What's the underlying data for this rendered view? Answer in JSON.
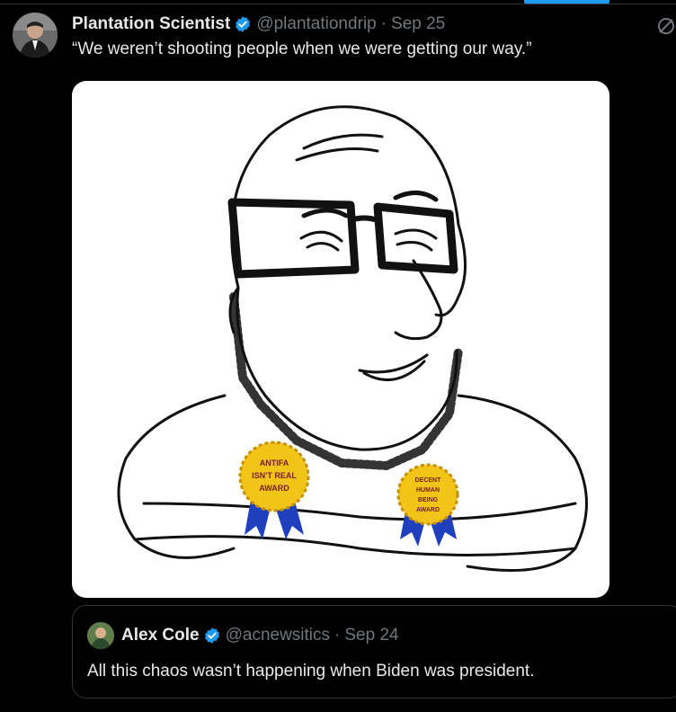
{
  "post": {
    "author_name": "Plantation Scientist",
    "handle": "@plantationdrip",
    "separator": "·",
    "date": "Sep 25",
    "text": "“We weren’t shooting people when we were getting our way.”"
  },
  "media": {
    "badge_left": [
      "ANTIFA",
      "ISN'T REAL",
      "AWARD"
    ],
    "badge_right": [
      "DECENT",
      "HUMAN",
      "BEING",
      "AWARD"
    ]
  },
  "quoted_post": {
    "author_name": "Alex Cole",
    "handle": "@acnewsitics",
    "separator": "·",
    "date": "Sep 24",
    "text": "All this chaos wasn’t happening when Biden was president."
  },
  "colors": {
    "background": "#000000",
    "text_primary": "#e7e9ea",
    "text_secondary": "#71767b",
    "accent": "#1d9bf0",
    "border": "#2f3336",
    "badge_gold": "#f2c418",
    "ribbon_blue": "#1f3fbf"
  },
  "icons": [
    "verified-badge-icon",
    "grok-icon"
  ]
}
